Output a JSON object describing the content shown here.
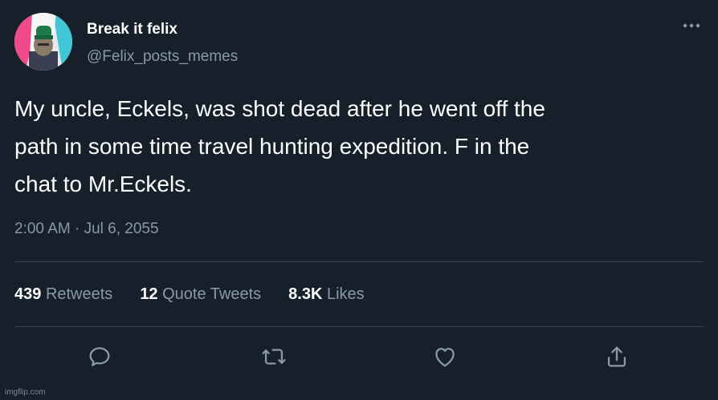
{
  "user": {
    "display_name": "Break it felix",
    "handle": "@Felix_posts_memes"
  },
  "tweet": {
    "text_lines": [
      "My uncle, Eckels, was shot dead after he went off the",
      "path in some time travel hunting expedition. F in the",
      "chat to Mr.Eckels."
    ],
    "timestamp": "2:00 AM · Jul 6, 2055"
  },
  "stats": {
    "retweets": {
      "count": "439",
      "label": "Retweets"
    },
    "quote_tweets": {
      "count": "12",
      "label": "Quote Tweets"
    },
    "likes": {
      "count": "8.3K",
      "label": "Likes"
    }
  },
  "actions": [
    "reply-icon",
    "retweet-icon",
    "like-icon",
    "share-icon"
  ],
  "watermark": "imgflip.com",
  "colors": {
    "background": "#15202b",
    "primary_text": "#ffffff",
    "secondary_text": "#8b98a5",
    "divider": "#38444d"
  }
}
